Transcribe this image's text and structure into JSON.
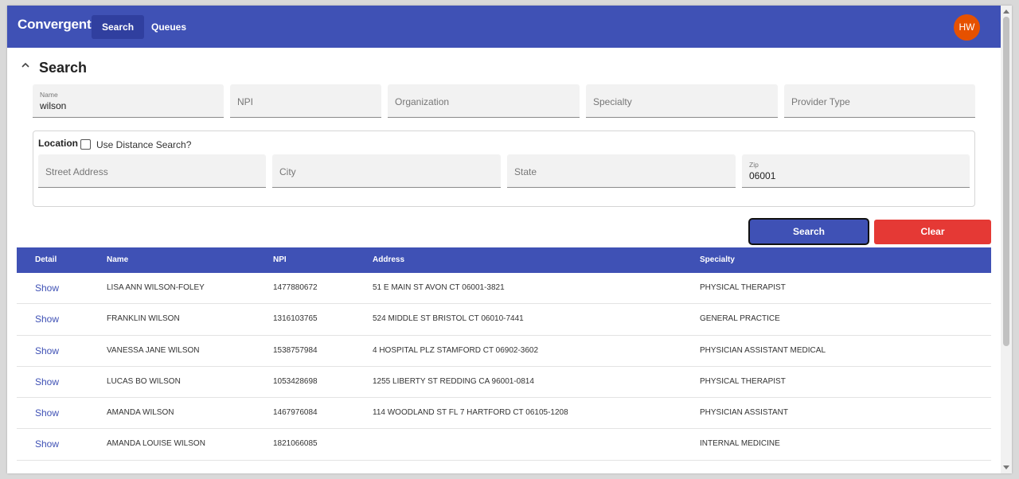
{
  "app": {
    "brand": "Convergent",
    "nav": [
      {
        "label": "Search",
        "active": true
      },
      {
        "label": "Queues",
        "active": false
      }
    ],
    "user_initials": "HW"
  },
  "search": {
    "title": "Search",
    "collapse_icon": "chevron-up-icon",
    "fields": {
      "name": {
        "label": "Name",
        "value": "wilson"
      },
      "npi": {
        "placeholder": "NPI"
      },
      "organization": {
        "placeholder": "Organization"
      },
      "specialty": {
        "placeholder": "Specialty"
      },
      "provider_type": {
        "placeholder": "Provider Type"
      }
    },
    "location": {
      "title": "Location",
      "distance_label": "Use Distance Search?",
      "distance_checked": false,
      "street": {
        "placeholder": "Street Address"
      },
      "city": {
        "placeholder": "City"
      },
      "state": {
        "placeholder": "State"
      },
      "zip": {
        "label": "Zip",
        "value": "06001"
      }
    },
    "search_button": "Search",
    "clear_button": "Clear"
  },
  "results": {
    "columns": [
      "Detail",
      "Name",
      "NPI",
      "Address",
      "Specialty"
    ],
    "rows": [
      {
        "detail": "Show",
        "name": "LISA ANN WILSON-FOLEY",
        "npi": "1477880672",
        "address": "51 E MAIN ST AVON CT 06001-3821",
        "specialty": "PHYSICAL THERAPIST"
      },
      {
        "detail": "Show",
        "name": "FRANKLIN WILSON",
        "npi": "1316103765",
        "address": "524 MIDDLE ST BRISTOL CT 06010-7441",
        "specialty": "GENERAL PRACTICE"
      },
      {
        "detail": "Show",
        "name": "VANESSA JANE WILSON",
        "npi": "1538757984",
        "address": "4 HOSPITAL PLZ STAMFORD CT 06902-3602",
        "specialty": "PHYSICIAN ASSISTANT MEDICAL"
      },
      {
        "detail": "Show",
        "name": "LUCAS BO WILSON",
        "npi": "1053428698",
        "address": "1255 LIBERTY ST REDDING CA 96001-0814",
        "specialty": "PHYSICAL THERAPIST"
      },
      {
        "detail": "Show",
        "name": "AMANDA WILSON",
        "npi": "1467976084",
        "address": "114 WOODLAND ST FL 7 HARTFORD CT 06105-1208",
        "specialty": "PHYSICIAN ASSISTANT"
      },
      {
        "detail": "Show",
        "name": "AMANDA LOUISE WILSON",
        "npi": "1821066085",
        "address": "",
        "specialty": "INTERNAL MEDICINE"
      }
    ]
  },
  "colors": {
    "primary": "#3f51b5",
    "primary_dark": "#303f9f",
    "danger": "#e53935",
    "avatar": "#e65100"
  }
}
